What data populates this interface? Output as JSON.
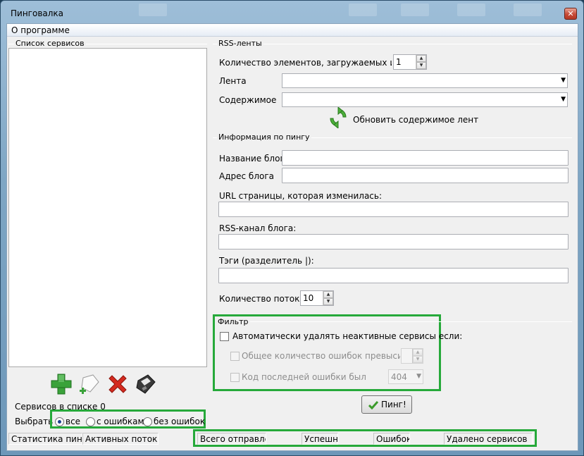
{
  "window": {
    "title": "Пинговалка"
  },
  "menu": {
    "about": "О программе"
  },
  "left": {
    "services_list_label": "Список сервисов",
    "services_count": "Сервисов в списке 0",
    "select_label": "Выбрать",
    "radio_all": "все",
    "radio_errors": "с ошибками",
    "radio_no_errors": "без ошибок",
    "toolbar_icons": [
      "add-icon",
      "add-page-icon",
      "delete-icon",
      "save-icon"
    ]
  },
  "rss": {
    "group_label": "RSS-ленты",
    "count_label": "Количество элементов, загружаемых из лент",
    "count_value": "1",
    "feed_label": "Лента",
    "content_label": "Содержимое",
    "refresh_button": "Обновить содержимое лент"
  },
  "ping": {
    "group_label": "Информация по пингу",
    "blog_name_label": "Название блога",
    "blog_address_label": "Адрес блога",
    "changed_url_label": "URL страницы, которая изменилась:",
    "rss_channel_label": "RSS-канал блога:",
    "tags_label": "Тэги (разделитель |):",
    "threads_label": "Количество потоков",
    "threads_value": "10"
  },
  "filter": {
    "group_label": "Фильтр",
    "auto_delete_label": "Автоматически удалять неактивные сервисы если:",
    "total_errors_label": "Общее количество ошибок превысило",
    "total_errors_value": "",
    "last_error_label": "Код последней ошибки был",
    "last_error_value": "404"
  },
  "ping_button": "Пинг!",
  "status": {
    "stats": "Статистика пинга",
    "active_threads": "Активных потоков",
    "total_sent": "Всего отправлено",
    "success": "Успешно",
    "errors": "Ошибок",
    "removed": "Удалено сервисов"
  },
  "colors": {
    "highlight": "#26a93a",
    "accent": "#1b3f8f"
  }
}
